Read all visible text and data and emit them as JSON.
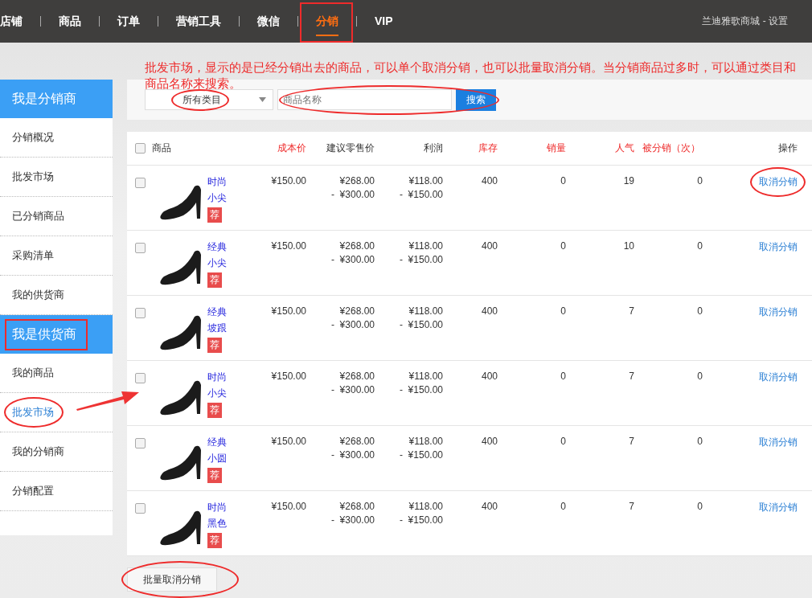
{
  "nav": {
    "items": [
      {
        "label": "店铺",
        "selected": false,
        "annotated": false
      },
      {
        "label": "商品",
        "selected": false,
        "annotated": false
      },
      {
        "label": "订单",
        "selected": false,
        "annotated": false
      },
      {
        "label": "营销工具",
        "selected": false,
        "annotated": false
      },
      {
        "label": "微信",
        "selected": false,
        "annotated": false
      },
      {
        "label": "分销",
        "selected": true,
        "annotated": true
      },
      {
        "label": "VIP",
        "selected": false,
        "annotated": false
      }
    ],
    "account": "兰迪雅歌商城 - 设置"
  },
  "annotation_note": "批发市场，显示的是已经分销出去的商品，可以单个取消分销，也可以批量取消分销。当分销商品过多时，可以通过类目和商品名称来搜索。",
  "sidebar": {
    "sections": [
      {
        "title": "我是分销商",
        "annotated": false,
        "items": [
          {
            "label": "分销概况",
            "selected": false,
            "annotated": false,
            "arrow": false
          },
          {
            "label": "批发市场",
            "selected": false,
            "annotated": false,
            "arrow": false
          },
          {
            "label": "已分销商品",
            "selected": false,
            "annotated": false,
            "arrow": false
          },
          {
            "label": "采购清单",
            "selected": false,
            "annotated": false,
            "arrow": false
          },
          {
            "label": "我的供货商",
            "selected": false,
            "annotated": false,
            "arrow": false
          }
        ]
      },
      {
        "title": "我是供货商",
        "annotated": true,
        "items": [
          {
            "label": "我的商品",
            "selected": false,
            "annotated": false,
            "arrow": false
          },
          {
            "label": "批发市场",
            "selected": true,
            "annotated": true,
            "arrow": true
          },
          {
            "label": "我的分销商",
            "selected": false,
            "annotated": false,
            "arrow": false
          },
          {
            "label": "分销配置",
            "selected": false,
            "annotated": false,
            "arrow": false
          }
        ]
      }
    ]
  },
  "filter": {
    "category": {
      "value": "所有类目",
      "annotated": true
    },
    "search": {
      "placeholder": "商品名称",
      "annotated": true
    },
    "search_button": "搜索"
  },
  "table": {
    "select_all": {
      "checked": false
    },
    "columns": [
      {
        "label": "商品",
        "highlighted": false
      },
      {
        "label": "成本价",
        "highlighted": true
      },
      {
        "label": "建议零售价",
        "highlighted": false
      },
      {
        "label": "利润",
        "highlighted": false
      },
      {
        "label": "库存",
        "highlighted": true
      },
      {
        "label": "销量",
        "highlighted": true
      },
      {
        "label": "人气",
        "highlighted": true
      },
      {
        "label": "被分销（次）",
        "highlighted": true
      },
      {
        "label": "操作",
        "highlighted": false
      }
    ],
    "rows": [
      {
        "checked": false,
        "name_lines": [
          "时尚",
          "小尖"
        ],
        "badge": "荐",
        "cost": "¥150.00",
        "retail": [
          "¥268.00",
          "-  ¥300.00"
        ],
        "profit": [
          "¥118.00",
          "-  ¥150.00"
        ],
        "stock": "400",
        "sales": "0",
        "popularity": "19",
        "distributed": "0",
        "action": "取消分销",
        "annotated": true
      },
      {
        "checked": false,
        "name_lines": [
          "经典",
          "小尖"
        ],
        "badge": "荐",
        "cost": "¥150.00",
        "retail": [
          "¥268.00",
          "-  ¥300.00"
        ],
        "profit": [
          "¥118.00",
          "-  ¥150.00"
        ],
        "stock": "400",
        "sales": "0",
        "popularity": "10",
        "distributed": "0",
        "action": "取消分销",
        "annotated": false
      },
      {
        "checked": false,
        "name_lines": [
          "经典",
          "坡跟"
        ],
        "badge": "荐",
        "cost": "¥150.00",
        "retail": [
          "¥268.00",
          "-  ¥300.00"
        ],
        "profit": [
          "¥118.00",
          "-  ¥150.00"
        ],
        "stock": "400",
        "sales": "0",
        "popularity": "7",
        "distributed": "0",
        "action": "取消分销",
        "annotated": false
      },
      {
        "checked": false,
        "name_lines": [
          "时尚",
          "小尖"
        ],
        "badge": "荐",
        "cost": "¥150.00",
        "retail": [
          "¥268.00",
          "-  ¥300.00"
        ],
        "profit": [
          "¥118.00",
          "-  ¥150.00"
        ],
        "stock": "400",
        "sales": "0",
        "popularity": "7",
        "distributed": "0",
        "action": "取消分销",
        "annotated": false
      },
      {
        "checked": false,
        "name_lines": [
          "经典",
          "小圆"
        ],
        "badge": "荐",
        "cost": "¥150.00",
        "retail": [
          "¥268.00",
          "-  ¥300.00"
        ],
        "profit": [
          "¥118.00",
          "-  ¥150.00"
        ],
        "stock": "400",
        "sales": "0",
        "popularity": "7",
        "distributed": "0",
        "action": "取消分销",
        "annotated": false
      },
      {
        "checked": false,
        "name_lines": [
          "时尚",
          "黑色"
        ],
        "badge": "荐",
        "cost": "¥150.00",
        "retail": [
          "¥268.00",
          "-  ¥300.00"
        ],
        "profit": [
          "¥118.00",
          "-  ¥150.00"
        ],
        "stock": "400",
        "sales": "0",
        "popularity": "7",
        "distributed": "0",
        "action": "取消分销",
        "annotated": false
      }
    ]
  },
  "batch_button": {
    "label": "批量取消分销",
    "annotated": true
  }
}
